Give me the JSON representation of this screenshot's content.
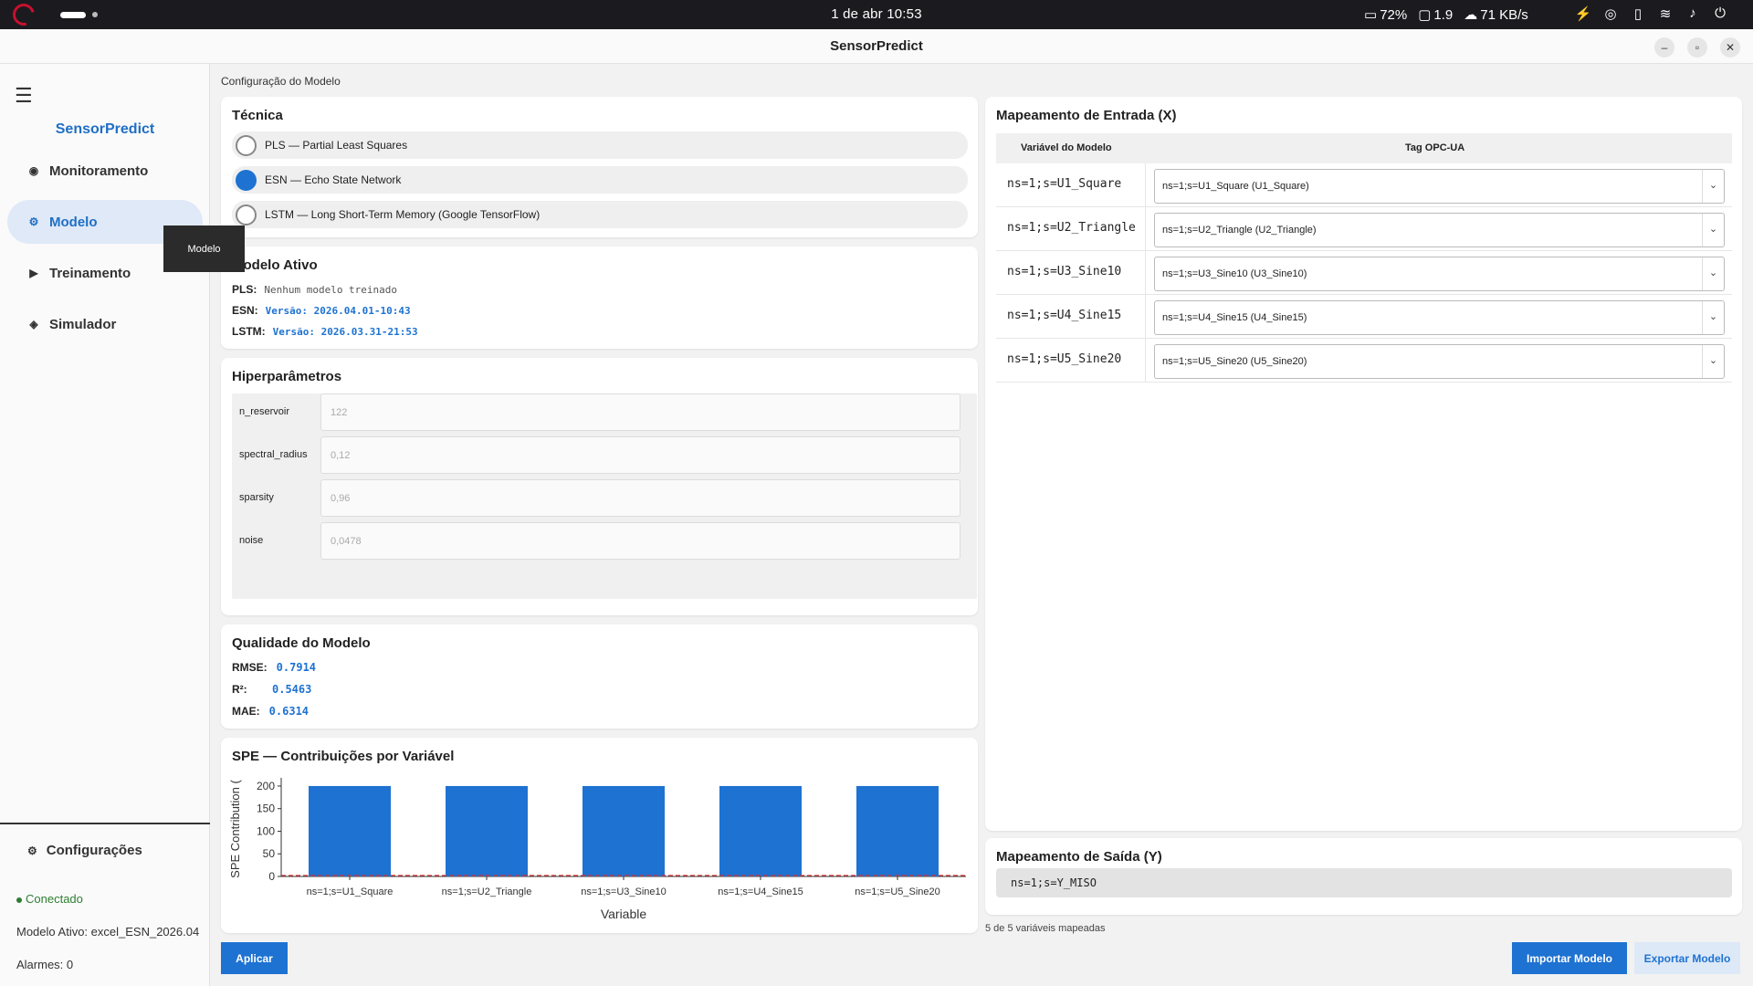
{
  "system_bar": {
    "clock": "1 de abr  10:53",
    "battery": "72%",
    "display": "1.9",
    "network_speed": "71 KB/s"
  },
  "window": {
    "title": "SensorPredict"
  },
  "sidebar": {
    "brand": "SensorPredict",
    "items": [
      {
        "label": "Monitoramento",
        "icon": "radio-dot-icon"
      },
      {
        "label": "Modelo",
        "icon": "gear-icon",
        "active": true
      },
      {
        "label": "Treinamento",
        "icon": "play-icon"
      },
      {
        "label": "Simulador",
        "icon": "diamond-icon"
      }
    ],
    "tooltip": "Modelo",
    "settings_label": "Configurações",
    "status": "Conectado",
    "active_model": "Modelo Ativo: excel_ESN_2026.04",
    "alarms": "Alarmes: 0"
  },
  "main": {
    "breadcrumb": "Configuração do Modelo",
    "technique": {
      "title": "Técnica",
      "options": [
        {
          "label": "PLS — Partial Least Squares",
          "selected": false
        },
        {
          "label": "ESN — Echo State Network",
          "selected": true
        },
        {
          "label": "LSTM — Long Short-Term Memory (Google TensorFlow)",
          "selected": false
        }
      ]
    },
    "active_model": {
      "title": "Modelo Ativo",
      "rows": [
        {
          "key": "PLS:",
          "value": "Nenhum modelo treinado"
        },
        {
          "key": "ESN:",
          "value": "Versão: 2026.04.01-10:43"
        },
        {
          "key": "LSTM:",
          "value": "Versão: 2026.03.31-21:53"
        }
      ]
    },
    "hyperparameters": {
      "title": "Hiperparâmetros",
      "fields": [
        {
          "name": "n_reservoir",
          "value": "122"
        },
        {
          "name": "spectral_radius",
          "value": "0,12"
        },
        {
          "name": "sparsity",
          "value": "0,96"
        },
        {
          "name": "noise",
          "value": "0,0478"
        }
      ]
    },
    "quality": {
      "title": "Qualidade do Modelo",
      "metrics": [
        {
          "name": "RMSE:",
          "value": "0.7914"
        },
        {
          "name": "R²:",
          "value": "0.5463"
        },
        {
          "name": "MAE:",
          "value": "0.6314"
        }
      ]
    },
    "spe": {
      "title": "SPE — Contribuições por Variável"
    },
    "input_mapping": {
      "title": "Mapeamento de Entrada (X)",
      "col_var": "Variável do Modelo",
      "col_tag": "Tag OPC-UA",
      "rows": [
        {
          "var": "ns=1;s=U1_Square",
          "tag": "ns=1;s=U1_Square (U1_Square)"
        },
        {
          "var": "ns=1;s=U2_Triangle",
          "tag": "ns=1;s=U2_Triangle (U2_Triangle)"
        },
        {
          "var": "ns=1;s=U3_Sine10",
          "tag": "ns=1;s=U3_Sine10 (U3_Sine10)"
        },
        {
          "var": "ns=1;s=U4_Sine15",
          "tag": "ns=1;s=U4_Sine15 (U4_Sine15)"
        },
        {
          "var": "ns=1;s=U5_Sine20",
          "tag": "ns=1;s=U5_Sine20 (U5_Sine20)"
        }
      ]
    },
    "output_mapping": {
      "title": "Mapeamento de Saída (Y)",
      "value": "ns=1;s=Y_MISO"
    },
    "mapped_count": "5 de 5 variáveis mapeadas",
    "buttons": {
      "apply": "Aplicar",
      "import": "Importar Modelo",
      "export": "Exportar Modelo"
    }
  },
  "colors": {
    "accent": "#1e72d1",
    "bar": "#1e72d1",
    "threshold": "#d32f2f"
  },
  "chart_data": {
    "type": "bar",
    "categories": [
      "ns=1;s=U1_Square",
      "ns=1;s=U2_Triangle",
      "ns=1;s=U3_Sine10",
      "ns=1;s=U4_Sine15",
      "ns=1;s=U5_Sine20"
    ],
    "values": [
      200,
      200,
      200,
      200,
      200
    ],
    "xlabel": "Variable",
    "ylabel": "SPE Contribution (",
    "ylim": [
      0,
      210
    ],
    "yticks": [
      0,
      50,
      100,
      150,
      200
    ],
    "threshold": 0,
    "grid": false
  }
}
